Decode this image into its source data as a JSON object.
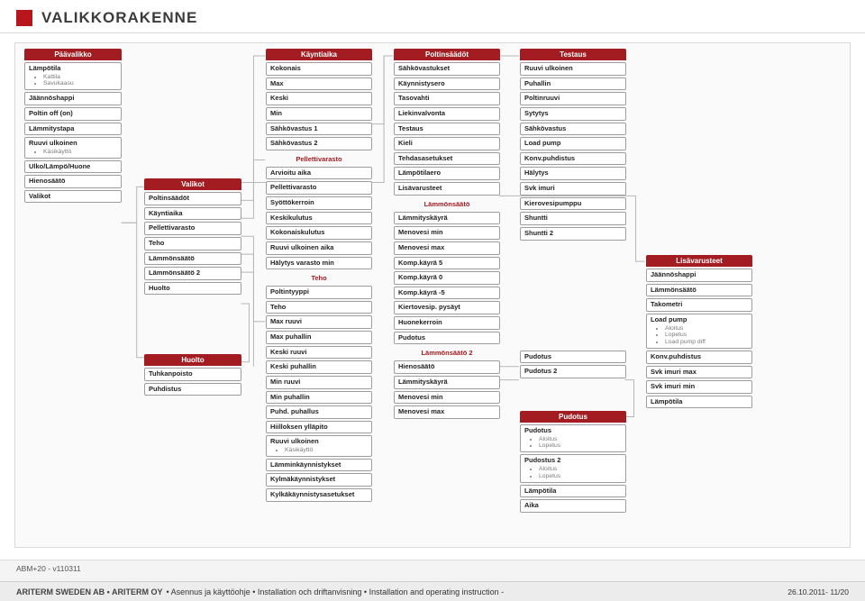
{
  "header": {
    "title": "VALIKKORAKENNE"
  },
  "col1": {
    "title": "Päävalikko",
    "items": [
      {
        "t": "Lämpötila",
        "sub": [
          "Kattila",
          "Savukaasu"
        ]
      },
      {
        "t": "Jäännöshappi"
      },
      {
        "t": "Poltin off (on)"
      },
      {
        "t": "Lämmitystapa"
      },
      {
        "t": "Ruuvi ulkoinen",
        "sub": [
          "Käsikäyttö"
        ]
      },
      {
        "t": "Ulko/Lämpö/Huone"
      },
      {
        "t": "Hienosäätö"
      },
      {
        "t": "Valikot"
      }
    ]
  },
  "col2": {
    "title": "Valikot",
    "items": [
      {
        "t": "Poltinsäädöt"
      },
      {
        "t": "Käyntiaika"
      },
      {
        "t": "Pellettivarasto"
      },
      {
        "t": "Teho"
      },
      {
        "t": "Lämmönsäätö"
      },
      {
        "t": "Lämmönsäätö 2"
      },
      {
        "t": "Huolto"
      }
    ]
  },
  "col2b": {
    "title": "Huolto",
    "items": [
      {
        "t": "Tuhkanpoisto"
      },
      {
        "t": "Puhdistus"
      }
    ]
  },
  "col3": {
    "title": "Käyntiaika",
    "items": [
      {
        "t": "Kokonais"
      },
      {
        "t": "Max"
      },
      {
        "t": "Keski"
      },
      {
        "t": "Min"
      },
      {
        "t": "Sähkövastus 1"
      },
      {
        "t": "Sähkövastus 2"
      }
    ],
    "sec2": {
      "title": "Pellettivarasto",
      "items": [
        {
          "t": "Arvioitu aika"
        },
        {
          "t": "Pellettivarasto"
        },
        {
          "t": "Syöttökerroin"
        },
        {
          "t": "Keskikulutus"
        },
        {
          "t": "Kokonaiskulutus"
        },
        {
          "t": "Ruuvi ulkoinen aika"
        },
        {
          "t": "Hälytys varasto min"
        }
      ]
    },
    "sec3": {
      "title": "Teho",
      "items": [
        {
          "t": "Poltintyyppi"
        },
        {
          "t": "Teho"
        },
        {
          "t": "Max ruuvi"
        },
        {
          "t": "Max puhallin"
        },
        {
          "t": "Keski ruuvi"
        },
        {
          "t": "Keski puhallin"
        },
        {
          "t": "Min ruuvi"
        },
        {
          "t": "Min puhallin"
        },
        {
          "t": "Puhd. puhallus"
        },
        {
          "t": "Hiilloksen ylläpito"
        },
        {
          "t": "Ruuvi ulkoinen",
          "sub": [
            "Käsikäyttö"
          ]
        },
        {
          "t": "Lämminkäynnistykset"
        },
        {
          "t": "Kylmäkäynnistykset"
        },
        {
          "t": "Kylkäkäynnistysasetukset"
        }
      ]
    }
  },
  "col4": {
    "title": "Poltinsäädöt",
    "items": [
      {
        "t": "Sähkövastukset"
      },
      {
        "t": "Käynnistysero"
      },
      {
        "t": "Tasovahti"
      },
      {
        "t": "Liekinvalvonta"
      },
      {
        "t": "Testaus"
      },
      {
        "t": "Kieli"
      },
      {
        "t": "Tehdasasetukset"
      },
      {
        "t": "Lämpötilaero"
      },
      {
        "t": "Lisävarusteet"
      }
    ],
    "sec2": {
      "title": "Lämmönsäätö",
      "items": [
        {
          "t": "Lämmityskäyrä"
        },
        {
          "t": "Menovesi min"
        },
        {
          "t": "Menovesi max"
        },
        {
          "t": "Komp.käyrä 5"
        },
        {
          "t": "Komp.käyrä 0"
        },
        {
          "t": "Komp.käyrä -5"
        },
        {
          "t": "Kiertovesip. pysäyt"
        },
        {
          "t": "Huonekerroin"
        },
        {
          "t": "Pudotus"
        }
      ]
    },
    "sec3": {
      "title": "Lämmönsäätö 2",
      "items": [
        {
          "t": "Hienosäätö"
        },
        {
          "t": "Lämmityskäyrä"
        },
        {
          "t": "Menovesi min"
        },
        {
          "t": "Menovesi max"
        }
      ]
    }
  },
  "col5": {
    "title": "Testaus",
    "items": [
      {
        "t": "Ruuvi ulkoinen"
      },
      {
        "t": "Puhallin"
      },
      {
        "t": "Poltinruuvi"
      },
      {
        "t": "Sytytys"
      },
      {
        "t": "Sähkövastus"
      },
      {
        "t": "Load pump"
      },
      {
        "t": "Konv.puhdistus"
      },
      {
        "t": "Hälytys"
      },
      {
        "t": "Svk imuri"
      },
      {
        "t": "Kierovesipumppu"
      },
      {
        "t": "Shuntti"
      },
      {
        "t": "Shuntti 2"
      }
    ]
  },
  "col5_extra": [
    {
      "t": "Pudotus"
    },
    {
      "t": "Pudotus 2"
    }
  ],
  "col5b": {
    "title": "Pudotus",
    "items": [
      {
        "t": "Pudotus",
        "sub": [
          "Aloitus",
          "Lopetus"
        ]
      },
      {
        "t": "Pudostus 2",
        "sub": [
          "Aloitus",
          "Lopetus"
        ]
      },
      {
        "t": "Lämpötila"
      },
      {
        "t": "Aika"
      }
    ]
  },
  "col6": {
    "title": "Lisävarusteet",
    "items": [
      {
        "t": "Jäännöshappi"
      },
      {
        "t": "Lämmönsäätö"
      },
      {
        "t": "Takometri"
      },
      {
        "t": "Load pump",
        "sub": [
          "Aloitus",
          "Lopetus",
          "Load pump diff"
        ]
      },
      {
        "t": "Konv.puhdistus"
      },
      {
        "t": "Svk imuri max"
      },
      {
        "t": "Svk imuri min"
      },
      {
        "t": "Lämpötila"
      }
    ]
  },
  "footer": {
    "version": "ABM+20 - v110311",
    "company": "ARITERM SWEDEN AB • ARITERM OY",
    "text": "• Asennus ja käyttöohje • Installation och driftanvisning • Installation and operating instruction -",
    "page": "26.10.2011- 11/20"
  }
}
